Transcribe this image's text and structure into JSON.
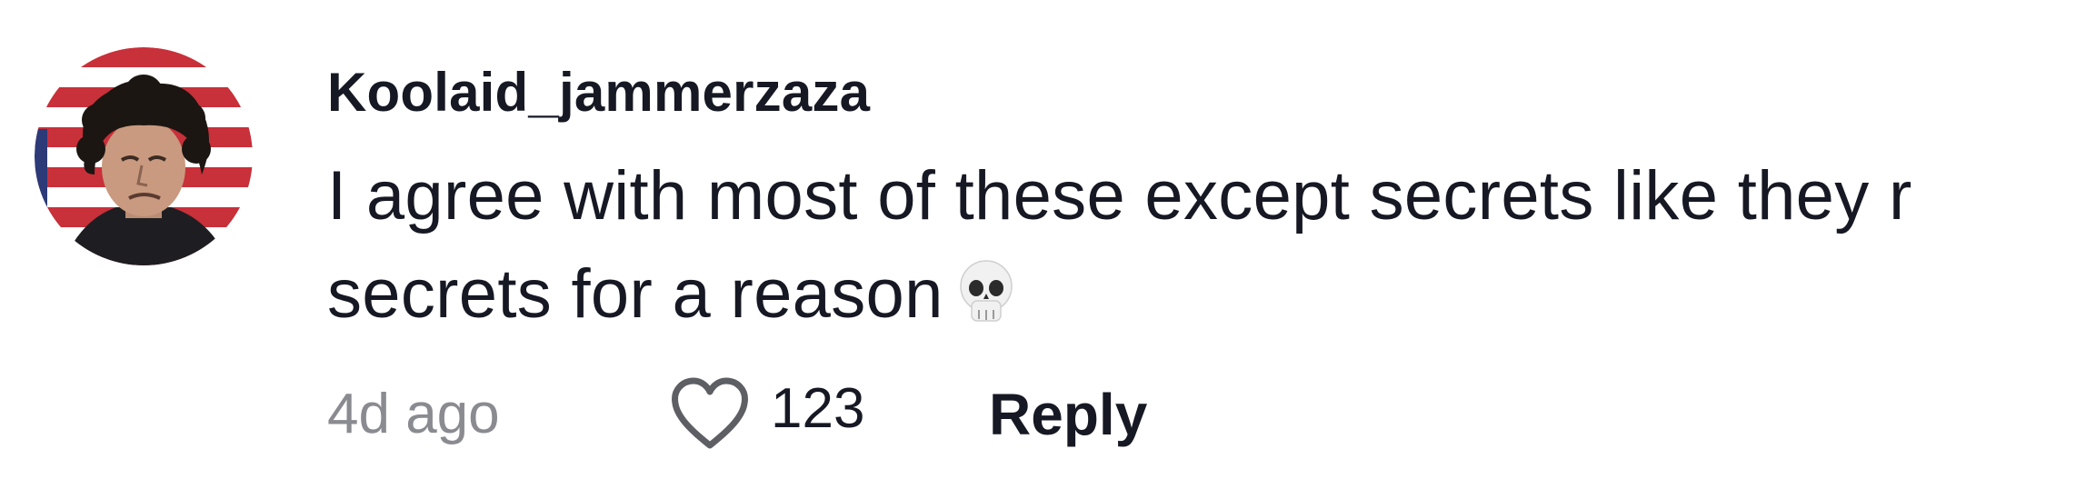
{
  "comment": {
    "username": "Koolaid_jammerzaza",
    "text": "I agree with most of these except secrets like they r secrets for a reason",
    "emoji_icon": "skull-emoji",
    "timestamp": "4d ago",
    "like_count": "123",
    "reply_label": "Reply",
    "like_icon": "heart-outline-icon"
  },
  "colors": {
    "text_primary": "#161823",
    "text_secondary": "#8a8b91",
    "heart_outline": "#5e5f64"
  }
}
